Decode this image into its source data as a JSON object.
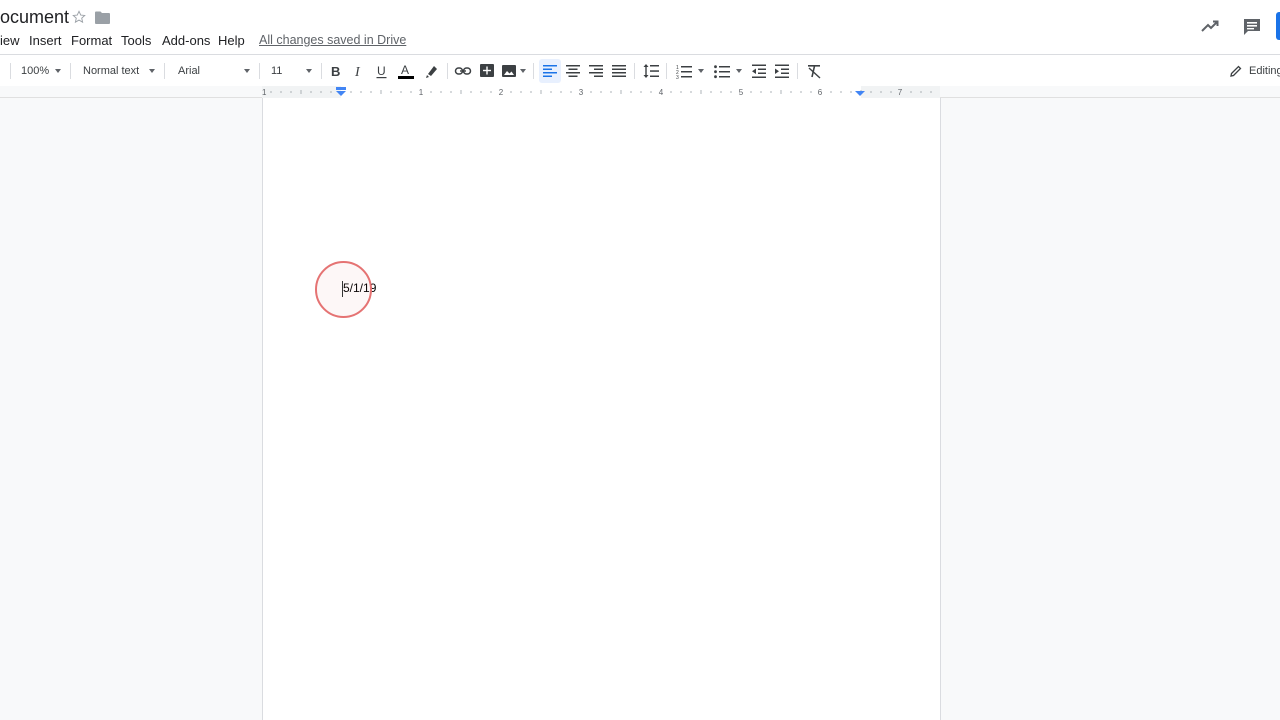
{
  "document": {
    "title": "ocument",
    "body_text": "5/1/19"
  },
  "menu": {
    "items": [
      "iew",
      "Insert",
      "Format",
      "Tools",
      "Add-ons",
      "Help"
    ],
    "status": "All changes saved in Drive"
  },
  "toolbar": {
    "zoom": "100%",
    "style": "Normal text",
    "font": "Arial",
    "font_size": "11",
    "mode": "Editing"
  },
  "ruler": {
    "labels": [
      "1",
      "1",
      "2",
      "3",
      "4",
      "5",
      "6",
      "7"
    ]
  },
  "colors": {
    "accent": "#1a73e8",
    "cursor_highlight": "#e57373",
    "text_color_bar": "#000000"
  },
  "icons": [
    "star-icon",
    "folder-icon",
    "trend-icon",
    "comment-icon",
    "bold-icon",
    "italic-icon",
    "underline-icon",
    "text-color-icon",
    "highlight-icon",
    "link-icon",
    "comment-add-icon",
    "image-icon",
    "align-left-icon",
    "align-center-icon",
    "align-right-icon",
    "align-justify-icon",
    "line-spacing-icon",
    "numbered-list-icon",
    "bulleted-list-icon",
    "decrease-indent-icon",
    "increase-indent-icon",
    "clear-formatting-icon",
    "pencil-icon"
  ]
}
